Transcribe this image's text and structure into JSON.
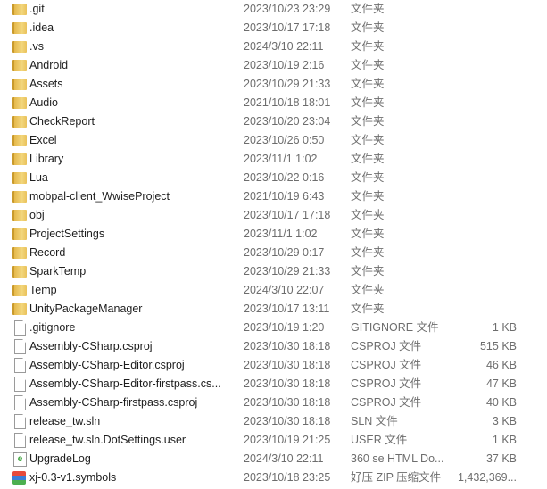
{
  "files": [
    {
      "name": ".git",
      "date": "2023/10/23 23:29",
      "type": "文件夹",
      "size": "",
      "icon": "folder"
    },
    {
      "name": ".idea",
      "date": "2023/10/17 17:18",
      "type": "文件夹",
      "size": "",
      "icon": "folder"
    },
    {
      "name": ".vs",
      "date": "2024/3/10 22:11",
      "type": "文件夹",
      "size": "",
      "icon": "folder"
    },
    {
      "name": "Android",
      "date": "2023/10/19 2:16",
      "type": "文件夹",
      "size": "",
      "icon": "folder"
    },
    {
      "name": "Assets",
      "date": "2023/10/29 21:33",
      "type": "文件夹",
      "size": "",
      "icon": "folder"
    },
    {
      "name": "Audio",
      "date": "2021/10/18 18:01",
      "type": "文件夹",
      "size": "",
      "icon": "folder"
    },
    {
      "name": "CheckReport",
      "date": "2023/10/20 23:04",
      "type": "文件夹",
      "size": "",
      "icon": "folder"
    },
    {
      "name": "Excel",
      "date": "2023/10/26 0:50",
      "type": "文件夹",
      "size": "",
      "icon": "folder"
    },
    {
      "name": "Library",
      "date": "2023/11/1 1:02",
      "type": "文件夹",
      "size": "",
      "icon": "folder"
    },
    {
      "name": "Lua",
      "date": "2023/10/22 0:16",
      "type": "文件夹",
      "size": "",
      "icon": "folder"
    },
    {
      "name": "mobpal-client_WwiseProject",
      "date": "2021/10/19 6:43",
      "type": "文件夹",
      "size": "",
      "icon": "folder"
    },
    {
      "name": "obj",
      "date": "2023/10/17 17:18",
      "type": "文件夹",
      "size": "",
      "icon": "folder"
    },
    {
      "name": "ProjectSettings",
      "date": "2023/11/1 1:02",
      "type": "文件夹",
      "size": "",
      "icon": "folder"
    },
    {
      "name": "Record",
      "date": "2023/10/29 0:17",
      "type": "文件夹",
      "size": "",
      "icon": "folder"
    },
    {
      "name": "SparkTemp",
      "date": "2023/10/29 21:33",
      "type": "文件夹",
      "size": "",
      "icon": "folder"
    },
    {
      "name": "Temp",
      "date": "2024/3/10 22:07",
      "type": "文件夹",
      "size": "",
      "icon": "folder"
    },
    {
      "name": "UnityPackageManager",
      "date": "2023/10/17 13:11",
      "type": "文件夹",
      "size": "",
      "icon": "folder"
    },
    {
      "name": ".gitignore",
      "date": "2023/10/19 1:20",
      "type": "GITIGNORE 文件",
      "size": "1 KB",
      "icon": "file"
    },
    {
      "name": "Assembly-CSharp.csproj",
      "date": "2023/10/30 18:18",
      "type": "CSPROJ 文件",
      "size": "515 KB",
      "icon": "file"
    },
    {
      "name": "Assembly-CSharp-Editor.csproj",
      "date": "2023/10/30 18:18",
      "type": "CSPROJ 文件",
      "size": "46 KB",
      "icon": "file"
    },
    {
      "name": "Assembly-CSharp-Editor-firstpass.cs...",
      "date": "2023/10/30 18:18",
      "type": "CSPROJ 文件",
      "size": "47 KB",
      "icon": "file"
    },
    {
      "name": "Assembly-CSharp-firstpass.csproj",
      "date": "2023/10/30 18:18",
      "type": "CSPROJ 文件",
      "size": "40 KB",
      "icon": "file"
    },
    {
      "name": "release_tw.sln",
      "date": "2023/10/30 18:18",
      "type": "SLN 文件",
      "size": "3 KB",
      "icon": "file"
    },
    {
      "name": "release_tw.sln.DotSettings.user",
      "date": "2023/10/19 21:25",
      "type": "USER 文件",
      "size": "1 KB",
      "icon": "file"
    },
    {
      "name": "UpgradeLog",
      "date": "2024/3/10 22:11",
      "type": "360 se HTML Do...",
      "size": "37 KB",
      "icon": "html"
    },
    {
      "name": "xj-0.3-v1.symbols",
      "date": "2023/10/18 23:25",
      "type": "好压 ZIP 压缩文件",
      "size": "1,432,369...",
      "icon": "zip"
    }
  ]
}
